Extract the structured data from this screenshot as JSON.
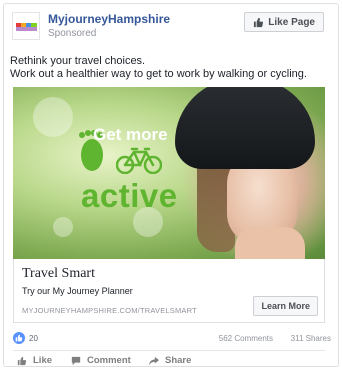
{
  "post": {
    "page_name": "MyjourneyHampshire",
    "sponsored_label": "Sponsored",
    "like_page_label": "Like Page",
    "message_lines": [
      "Rethink your travel choices.",
      "Work out a healthier way to get to work by walking or cycling."
    ]
  },
  "ad": {
    "headline_small": "Get more",
    "headline_large": "active",
    "link_title": "Travel Smart",
    "link_description": "Try our My Journey Planner",
    "link_url": "MYJOURNEYHAMPSHIRE.COM/TRAVELSMART",
    "cta_label": "Learn More",
    "accent_color": "#5fb430"
  },
  "stats": {
    "reactions": "20",
    "comments": "562 Comments",
    "shares": "311 Shares"
  },
  "actions": {
    "like": "Like",
    "comment": "Comment",
    "share": "Share"
  }
}
